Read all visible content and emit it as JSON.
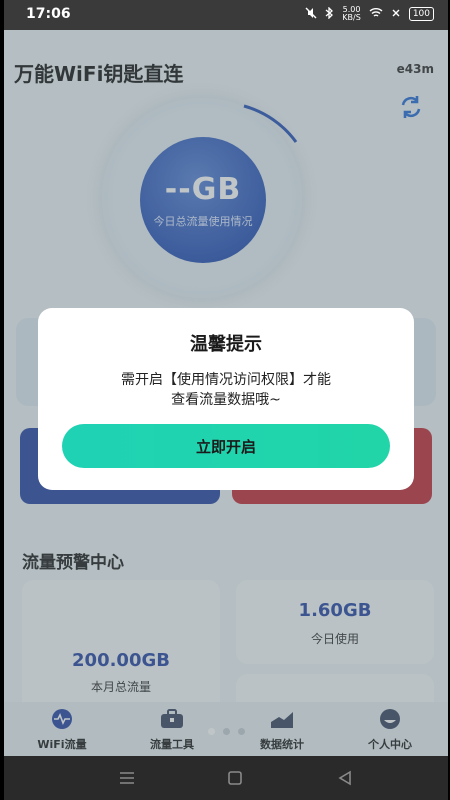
{
  "status_bar": {
    "time": "17:06",
    "speed_value": "5.00",
    "speed_unit": "KB/S",
    "battery": "100"
  },
  "app": {
    "title": "万能WiFi钥匙直连",
    "subtitle": "e43m"
  },
  "gauge": {
    "value": "--GB",
    "caption": "今日总流量使用情况"
  },
  "warning_center": {
    "title": "流量预警中心",
    "month_total": {
      "value": "200.00GB",
      "label": "本月总流量"
    },
    "today_used": {
      "value": "1.60GB",
      "label": "今日使用"
    }
  },
  "tabs": [
    {
      "label": "WiFi流量",
      "icon": "wave-icon"
    },
    {
      "label": "流量工具",
      "icon": "toolbox-icon"
    },
    {
      "label": "数据统计",
      "icon": "chart-icon"
    },
    {
      "label": "个人中心",
      "icon": "face-icon"
    }
  ],
  "dialog": {
    "title": "温馨提示",
    "message_line1": "需开启【使用情况访问权限】才能",
    "message_line2": "查看流量数据哦~",
    "button": "立即开启"
  },
  "colors": {
    "accent_blue": "#2b4aa6",
    "accent_red": "#c3303c",
    "button_teal": "#1fd2b4"
  }
}
